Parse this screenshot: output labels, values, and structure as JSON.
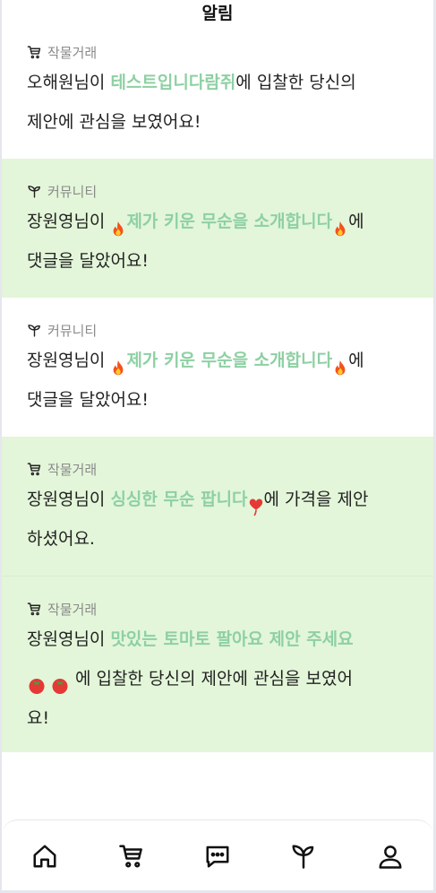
{
  "header": {
    "title": "알림"
  },
  "notifications": [
    {
      "category": "작물거래",
      "category_icon": "cart-icon",
      "user": "오해원님이 ",
      "highlight": "테스트입니다람쥐",
      "rest1": "에 입찰한 당신의",
      "line2": "제안에 관심을 보였어요!"
    },
    {
      "category": "커뮤니티",
      "category_icon": "sprout-icon",
      "user": "장원영님이 ",
      "highlight": "제가 키운 무순을 소개합니다",
      "rest1": "에",
      "line2": "댓글을 달았어요!"
    },
    {
      "category": "커뮤니티",
      "category_icon": "sprout-icon",
      "user": "장원영님이 ",
      "highlight": "제가 키운 무순을 소개합니다",
      "rest1": "에",
      "line2": "댓글을 달았어요!"
    },
    {
      "category": "작물거래",
      "category_icon": "cart-icon",
      "user": "장원영님이 ",
      "highlight": "싱싱한 무순 팝니다",
      "rest1": "에 가격을 제안",
      "line2": "하셨어요."
    },
    {
      "category": "작물거래",
      "category_icon": "cart-icon",
      "user": "장원영님이 ",
      "highlight": "맛있는 토마토 팔아요 제안 주세요",
      "rest1": " 에 입찰한 당신의 제안에 관심을 보였어",
      "line2": "요!"
    }
  ],
  "nav": [
    {
      "name": "home",
      "icon": "home-icon"
    },
    {
      "name": "trade",
      "icon": "cart-icon"
    },
    {
      "name": "chat",
      "icon": "chat-icon"
    },
    {
      "name": "community",
      "icon": "sprout-icon"
    },
    {
      "name": "profile",
      "icon": "person-icon"
    }
  ],
  "colors": {
    "highlight": "#8ed0a3",
    "green_bg": "#e3f6d9",
    "category_text": "#8a8a8a"
  }
}
